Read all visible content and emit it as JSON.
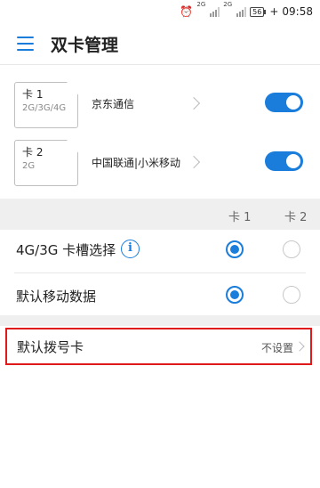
{
  "status_bar": {
    "network_1": "2G",
    "network_2": "2G",
    "battery": "56",
    "time": "09:58"
  },
  "app_bar": {
    "title": "双卡管理",
    "menu_icon": "menu-icon"
  },
  "sims": [
    {
      "name": "卡 1",
      "types": "2G/3G/4G",
      "operator": "京东通信",
      "enabled": true
    },
    {
      "name": "卡 2",
      "types": "2G",
      "operator": "中国联通|小米移动",
      "enabled": true
    }
  ],
  "columns": {
    "card1": "卡 1",
    "card2": "卡 2"
  },
  "preferences": [
    {
      "label": "4G/3G 卡槽选择",
      "selected": "card1",
      "has_info": true
    },
    {
      "label": "默认移动数据",
      "selected": "card1",
      "has_info": false
    }
  ],
  "default_dial": {
    "label": "默认拨号卡",
    "value": "不设置"
  },
  "colors": {
    "accent": "#1a7ddc",
    "highlight": "#e01a1a"
  }
}
